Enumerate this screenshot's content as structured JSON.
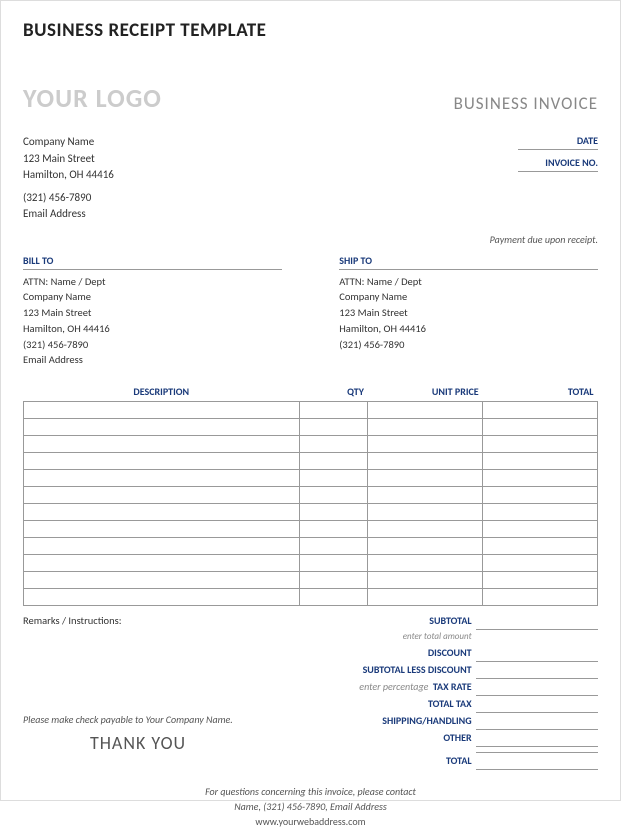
{
  "page_title": "BUSINESS RECEIPT TEMPLATE",
  "logo_text": "YOUR LOGO",
  "invoice_label": "BUSINESS INVOICE",
  "company": {
    "name": "Company Name",
    "street": "123 Main Street",
    "city": "Hamilton, OH  44416",
    "phone": "(321) 456-7890",
    "email": "Email Address"
  },
  "date_label": "DATE",
  "invoice_no_label": "INVOICE NO.",
  "payment_note": "Payment due upon receipt.",
  "bill_to": {
    "header": "BILL TO",
    "attn": "ATTN: Name / Dept",
    "company": "Company Name",
    "street": "123 Main Street",
    "city": "Hamilton, OH  44416",
    "phone": "(321) 456-7890",
    "email": "Email Address"
  },
  "ship_to": {
    "header": "SHIP TO",
    "attn": "ATTN: Name / Dept",
    "company": "Company Name",
    "street": "123 Main Street",
    "city": "Hamilton, OH  44416",
    "phone": "(321) 456-7890"
  },
  "columns": {
    "desc": "DESCRIPTION",
    "qty": "QTY",
    "unit_price": "UNIT PRICE",
    "total": "TOTAL"
  },
  "remarks_label": "Remarks / Instructions:",
  "payable_text": "Please make check payable to Your Company Name.",
  "thank_you": "THANK YOU",
  "totals": {
    "subtotal": "SUBTOTAL",
    "subtotal_hint": "enter total amount",
    "discount": "DISCOUNT",
    "subtotal_less": "SUBTOTAL LESS DISCOUNT",
    "tax_rate_hint": "enter percentage",
    "tax_rate": "TAX RATE",
    "total_tax": "TOTAL TAX",
    "shipping": "SHIPPING/HANDLING",
    "other": "OTHER",
    "total": "TOTAL"
  },
  "footer": {
    "line1": "For questions concerning this invoice, please contact",
    "line2": "Name, (321) 456-7890, Email Address",
    "line3": "www.yourwebaddress.com"
  }
}
